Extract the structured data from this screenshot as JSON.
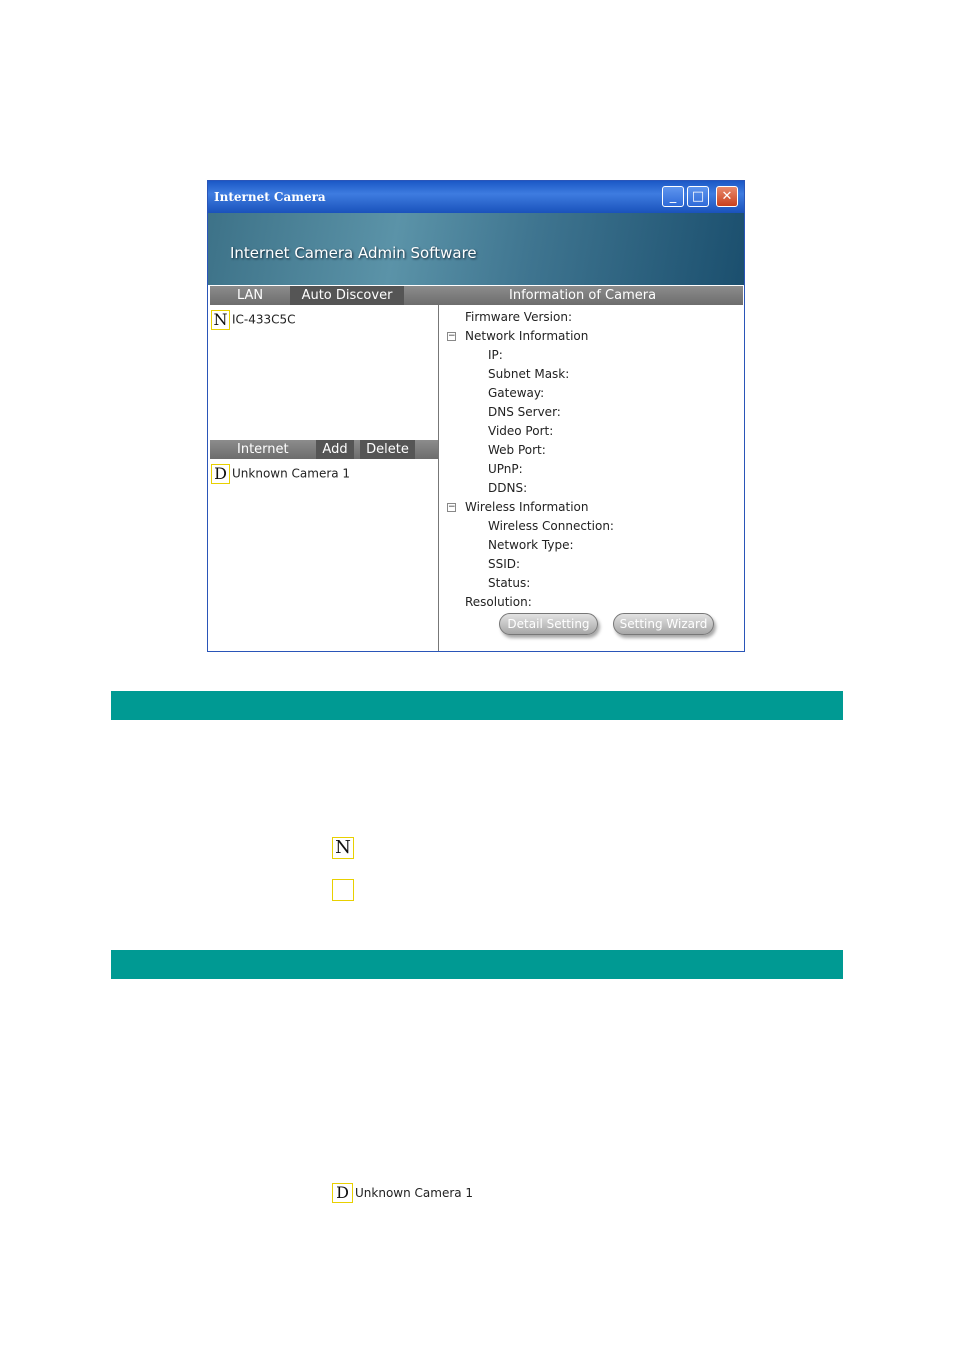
{
  "window": {
    "title": "Internet Camera",
    "banner": "Internet Camera Admin Software",
    "controls": {
      "minimize": "_",
      "maximize": "□",
      "close": "✕"
    }
  },
  "lan": {
    "header": "LAN",
    "auto_discover": "Auto Discover",
    "cameras": [
      {
        "badge": "N",
        "name": "IC-433C5C"
      }
    ]
  },
  "internet": {
    "header": "Internet",
    "add": "Add",
    "delete": "Delete",
    "cameras": [
      {
        "badge": "D",
        "name": "Unknown Camera 1"
      }
    ]
  },
  "info": {
    "header": "Information of Camera",
    "firmware": "Firmware Version:",
    "network_group": "Network Information",
    "network_fields": [
      "IP:",
      "Subnet Mask:",
      "Gateway:",
      "DNS Server:",
      "Video Port:",
      "Web Port:",
      "UPnP:",
      "DDNS:"
    ],
    "wireless_group": "Wireless Information",
    "wireless_fields": [
      "Wireless Connection:",
      "Network Type:",
      "SSID:",
      "Status:"
    ],
    "resolution": "Resolution:",
    "detail_setting": "Detail Setting",
    "setting_wizard": "Setting Wizard"
  },
  "doc": {
    "badge_n": "N",
    "badge_empty": "",
    "badge_d": "D",
    "camera_label": "Unknown Camera 1"
  }
}
